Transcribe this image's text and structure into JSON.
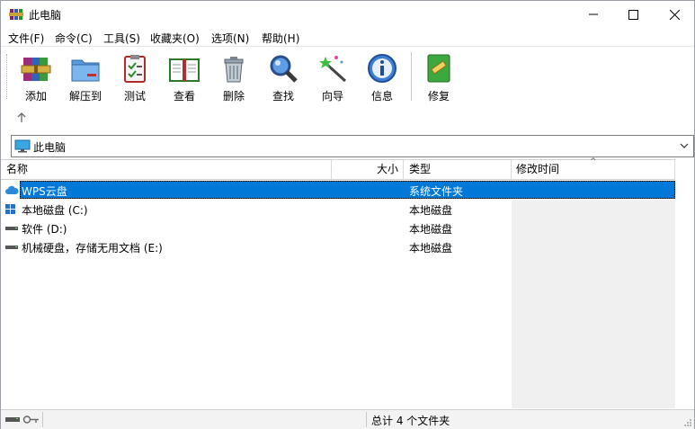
{
  "window": {
    "title": "此电脑"
  },
  "menu": [
    "文件(F)",
    "命令(C)",
    "工具(S)",
    "收藏夹(O)",
    "选项(N)",
    "帮助(H)"
  ],
  "toolbar": {
    "add": "添加",
    "extract": "解压到",
    "test": "测试",
    "view": "查看",
    "delete": "删除",
    "find": "查找",
    "wizard": "向导",
    "info": "信息",
    "repair": "修复"
  },
  "address": {
    "path": "此电脑"
  },
  "columns": {
    "name": "名称",
    "size": "大小",
    "type": "类型",
    "modified": "修改时间"
  },
  "rows": [
    {
      "name": "WPS云盘",
      "type": "系统文件夹",
      "selected": true,
      "icon": "cloud-icon"
    },
    {
      "name": "本地磁盘 (C:)",
      "type": "本地磁盘",
      "icon": "windows-drive-icon"
    },
    {
      "name": "软件 (D:)",
      "type": "本地磁盘",
      "icon": "drive-icon"
    },
    {
      "name": "机械硬盘，存储无用文档 (E:)",
      "type": "本地磁盘",
      "icon": "drive-icon"
    }
  ],
  "status": {
    "summary": "总计 4 个文件夹"
  },
  "colors": {
    "selection": "#0078d7",
    "grid_grey": "#f0f0f0"
  }
}
